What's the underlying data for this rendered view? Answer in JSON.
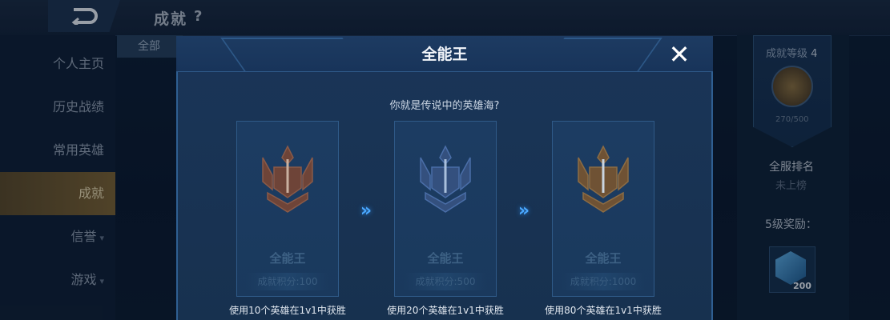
{
  "header": {
    "title": "成就",
    "help": "?"
  },
  "sidebar": {
    "items": [
      {
        "label": "个人主页",
        "active": false,
        "chevron": false
      },
      {
        "label": "历史战绩",
        "active": false,
        "chevron": false
      },
      {
        "label": "常用英雄",
        "active": false,
        "chevron": false
      },
      {
        "label": "成就",
        "active": true,
        "chevron": false
      },
      {
        "label": "信誉",
        "active": false,
        "chevron": true
      },
      {
        "label": "游戏",
        "active": false,
        "chevron": true
      }
    ]
  },
  "filter_tab": {
    "label": "全部"
  },
  "right_panel": {
    "achievement_level_label": "成就等级",
    "achievement_level": "4",
    "progress": "270/500",
    "server_rank_label": "全服排名",
    "server_rank_value": "未上榜",
    "reward_label": "5级奖励：",
    "reward_count": "200"
  },
  "modal": {
    "title": "全能王",
    "close_icon": "close-icon",
    "subtitle": "你就是传说中的英雄海?",
    "cards": [
      {
        "name": "全能王",
        "points": "成就积分:100",
        "desc": "使用10个英雄在1v1中获胜",
        "tier_color": "#7a4a3c"
      },
      {
        "name": "全能王",
        "points": "成就积分:500",
        "desc": "使用20个英雄在1v1中获胜",
        "tier_color": "#3f5f9a"
      },
      {
        "name": "全能王",
        "points": "成就积分:1000",
        "desc": "使用80个英雄在1v1中获胜",
        "tier_color": "#7a5a36"
      }
    ],
    "arrow_glyph": "»"
  },
  "colors": {
    "accent_blue": "#4aa8ff",
    "active_gold": "#7a6234"
  }
}
